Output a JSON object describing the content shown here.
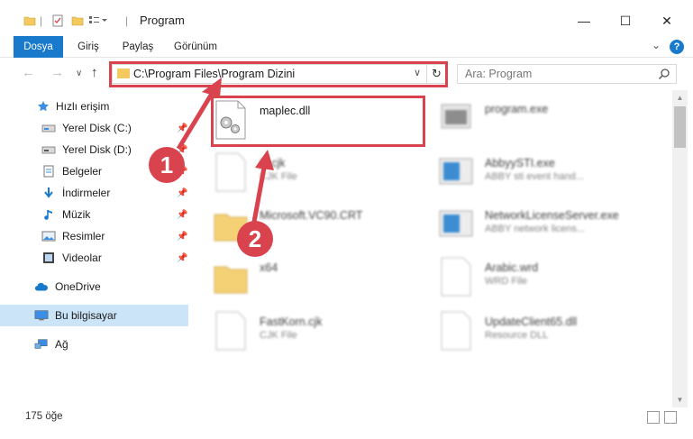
{
  "window": {
    "title": "Program",
    "controls": {
      "minimize": "—",
      "maximize": "☐",
      "close": "✕"
    }
  },
  "ribbon": {
    "tabs": [
      {
        "label": "Dosya",
        "active": true
      },
      {
        "label": "Giriş"
      },
      {
        "label": "Paylaş"
      },
      {
        "label": "Görünüm"
      }
    ],
    "help": "?"
  },
  "address": {
    "path": "C:\\Program Files\\Program Dizini",
    "dropdown": "∨",
    "refresh": "↻"
  },
  "search": {
    "placeholder": "Ara: Program"
  },
  "nav": {
    "items": [
      {
        "label": "Hızlı erişim",
        "icon": "star-icon"
      },
      {
        "label": "Yerel Disk (C:)",
        "icon": "drive-icon",
        "pinned": true
      },
      {
        "label": "Yerel Disk (D:)",
        "icon": "drive-icon",
        "pinned": true
      },
      {
        "label": "Belgeler",
        "icon": "documents-icon",
        "pinned": true
      },
      {
        "label": "İndirmeler",
        "icon": "download-icon",
        "pinned": true
      },
      {
        "label": "Müzik",
        "icon": "music-icon",
        "pinned": true
      },
      {
        "label": "Resimler",
        "icon": "pictures-icon",
        "pinned": true
      },
      {
        "label": "Videolar",
        "icon": "videos-icon",
        "pinned": true
      },
      {
        "label": "OneDrive",
        "icon": "cloud-icon"
      },
      {
        "label": "Bu bilgisayar",
        "icon": "computer-icon",
        "selected": true
      },
      {
        "label": "Ağ",
        "icon": "network-icon"
      }
    ]
  },
  "files": {
    "left": [
      {
        "name": "maplec.dll",
        "type": "",
        "icon": "dll-gear-icon"
      },
      {
        "name": "ja.cjk",
        "type": "CJK File",
        "icon": "file-icon"
      },
      {
        "name": "Microsoft.VC90.CRT",
        "type": "",
        "icon": "folder-icon"
      },
      {
        "name": "x64",
        "type": "",
        "icon": "folder-icon"
      },
      {
        "name": "FastKorn.cjk",
        "type": "CJK File",
        "icon": "file-icon"
      }
    ],
    "right": [
      {
        "name": "program.exe",
        "type": "",
        "icon": "exe-icon"
      },
      {
        "name": "AbbyySTI.exe",
        "type": "ABBY sti event hand...",
        "icon": "app-icon"
      },
      {
        "name": "NetworkLicenseServer.exe",
        "type": "ABBY network licens...",
        "icon": "app-icon"
      },
      {
        "name": "Arabic.wrd",
        "type": "WRD File",
        "icon": "file-icon"
      },
      {
        "name": "UpdateClient65.dll",
        "type": "Resource DLL",
        "icon": "file-icon"
      }
    ]
  },
  "status": {
    "count": "175 öğe"
  },
  "annotations": [
    {
      "label": "1",
      "color": "#d9434d"
    },
    {
      "label": "2",
      "color": "#d9434d"
    }
  ],
  "colors": {
    "accent": "#1979ca",
    "selection": "#cce4f7",
    "highlight": "#d9434d",
    "folder": "#f4c95d"
  }
}
